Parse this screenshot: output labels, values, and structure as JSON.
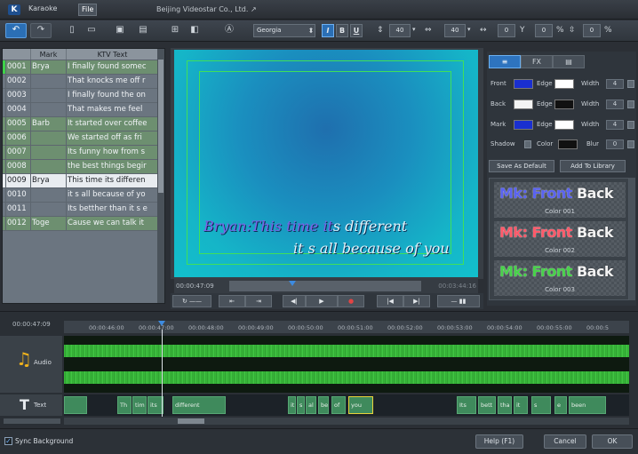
{
  "titlebar": {
    "logo": "K",
    "menu": [
      "Karaoke",
      "File"
    ],
    "company": "Beijing Videostar Co., Ltd. ↗"
  },
  "toolbar": {
    "font": "Georgia",
    "bold": "B",
    "italic": "I",
    "underline": "U",
    "size1": "40",
    "size2": "40",
    "spacing": "0",
    "offset": "0",
    "percent": "0",
    "pct_sign": "%"
  },
  "list": {
    "headers": [
      "",
      "Mark",
      "KTV Text"
    ],
    "rows": [
      {
        "id": "0001",
        "mark": "Brya",
        "text": "I finally found somec",
        "state": "green"
      },
      {
        "id": "0002",
        "mark": "",
        "text": "That knocks me off r",
        "state": ""
      },
      {
        "id": "0003",
        "mark": "",
        "text": "I finally found the on",
        "state": ""
      },
      {
        "id": "0004",
        "mark": "",
        "text": "That makes me feel",
        "state": ""
      },
      {
        "id": "0005",
        "mark": "Barb",
        "text": "It started over coffee",
        "state": "green"
      },
      {
        "id": "0006",
        "mark": "",
        "text": "We started off as fri",
        "state": "green"
      },
      {
        "id": "0007",
        "mark": "",
        "text": "Its funny how from s",
        "state": "green"
      },
      {
        "id": "0008",
        "mark": "",
        "text": "the best things begir",
        "state": "green"
      },
      {
        "id": "0009",
        "mark": "Brya",
        "text": "This time its differen",
        "state": "selected"
      },
      {
        "id": "0010",
        "mark": "",
        "text": "it s all because of yo",
        "state": ""
      },
      {
        "id": "0011",
        "mark": "",
        "text": "Its betther than it s e",
        "state": ""
      },
      {
        "id": "0012",
        "mark": "Toge",
        "text": "Cause we can talk it",
        "state": "green"
      }
    ]
  },
  "preview": {
    "line1_sung": "Bryan:This time it",
    "line1_rest": "s different",
    "line2": "it s all because of you",
    "time_current": "00:00:47:09",
    "time_total": "00:03:44:16",
    "progress": 0.33
  },
  "style_panel": {
    "tabs": [
      "≡",
      "FX",
      "▤"
    ],
    "rows": [
      {
        "label": "Front",
        "edge": "Edge",
        "width_label": "Width",
        "width": "4",
        "color": "#1a2fd0",
        "edge_color": "#ffffff"
      },
      {
        "label": "Back",
        "edge": "Edge",
        "width_label": "Width",
        "width": "4",
        "color": "#f4f4f4",
        "edge_color": "#111111"
      },
      {
        "label": "Mark",
        "edge": "Edge",
        "width_label": "Width",
        "width": "4",
        "color": "#1a2fd0",
        "edge_color": "#ffffff"
      }
    ],
    "shadow": {
      "label": "Shadow",
      "color_label": "Color",
      "blur_label": "Blur",
      "blur": "0"
    },
    "save_default": "Save As Default",
    "add_library": "Add To Library",
    "samples": [
      {
        "mk": "Mk:",
        "front": "Front",
        "back": "Back",
        "caption": "Color 001",
        "mk_color": "#5a63f0",
        "front_color": "#5a63f0"
      },
      {
        "mk": "Mk:",
        "front": "Front",
        "back": "Back",
        "caption": "Color 002",
        "mk_color": "#ff5a6a",
        "front_color": "#ff5a6a"
      },
      {
        "mk": "Mk:",
        "front": "Front",
        "back": "Back",
        "caption": "Color 003",
        "mk_color": "#48d24a",
        "front_color": "#48d24a"
      }
    ]
  },
  "timeline": {
    "current": "00:00:47:09",
    "ticks": [
      "00:00:46:00",
      "00:00:47:00",
      "00:00:48:00",
      "00:00:49:00",
      "00:00:50:00",
      "00:00:51:00",
      "00:00:52:00",
      "00:00:53:00",
      "00:00:54:00",
      "00:00:55:00",
      "00:00:5"
    ],
    "audio_label": "Audio",
    "text_label": "Text",
    "segments": [
      {
        "text": "",
        "cur": false
      },
      {
        "text": "Th",
        "cur": false
      },
      {
        "text": "tim",
        "cur": false
      },
      {
        "text": "its",
        "cur": false
      },
      {
        "text": "different",
        "cur": false
      },
      {
        "text": "it",
        "cur": false
      },
      {
        "text": "s",
        "cur": false
      },
      {
        "text": "al",
        "cur": false
      },
      {
        "text": "be",
        "cur": false
      },
      {
        "text": "of",
        "cur": false
      },
      {
        "text": "you",
        "cur": true
      },
      {
        "text": "Its",
        "cur": false
      },
      {
        "text": "bett",
        "cur": false
      },
      {
        "text": "tha",
        "cur": false
      },
      {
        "text": "it",
        "cur": false
      },
      {
        "text": "s",
        "cur": false
      },
      {
        "text": "e",
        "cur": false
      },
      {
        "text": "been",
        "cur": false
      }
    ]
  },
  "footer": {
    "sync_label": "Sync Background",
    "help": "Help (F1)",
    "cancel": "Cancel",
    "ok": "OK"
  }
}
